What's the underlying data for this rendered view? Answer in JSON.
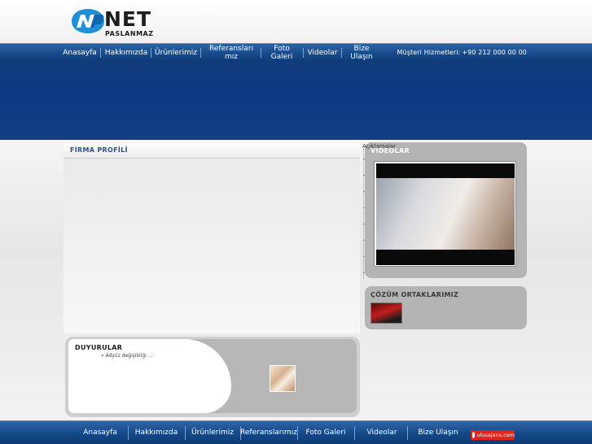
{
  "header": {
    "logo_text": "NET",
    "logo_subtext": "PASLANMAZ"
  },
  "topnav": {
    "items": [
      {
        "label": "Anasayfa"
      },
      {
        "label": "Hakkımızda"
      },
      {
        "label": "Ürünlerimiz"
      },
      {
        "label": "Referanslarımız"
      },
      {
        "label": "Foto Galeri"
      },
      {
        "label": "Videolar"
      },
      {
        "label": "Bize Ulaşın"
      }
    ],
    "support_label": "Müşteri Hizmetleri:",
    "support_phone": "+90 212 000 00 00"
  },
  "main": {
    "firma_title": "FİRMA PROFİLİ",
    "aciklamalar": "Açıklamalar",
    "videos_title": "VİDEOLAR",
    "partners_title": "ÇÖZÜM ORTAKLARIMIZ",
    "news_title": "DUYURULAR",
    "news_items": [
      "» Adyüz değişikliği ..."
    ]
  },
  "footer": {
    "items": [
      {
        "label": "Anasayfa"
      },
      {
        "label": "Hakkımızda"
      },
      {
        "label": "Ürünlerimiz"
      },
      {
        "label": "Referanslarımız"
      },
      {
        "label": "Foto Galeri"
      },
      {
        "label": "Videolar"
      },
      {
        "label": "Bize Ulaşın"
      }
    ],
    "badge_text": "ulusajans.com"
  },
  "colors": {
    "nav_blue": "#174a8a",
    "banner_blue": "#0d3a85",
    "panel_grey": "#b4b4b4",
    "badge_red": "#e2231a"
  },
  "icons": {
    "logo": "net-logo-mark",
    "badge": "agency-logo-icon"
  }
}
